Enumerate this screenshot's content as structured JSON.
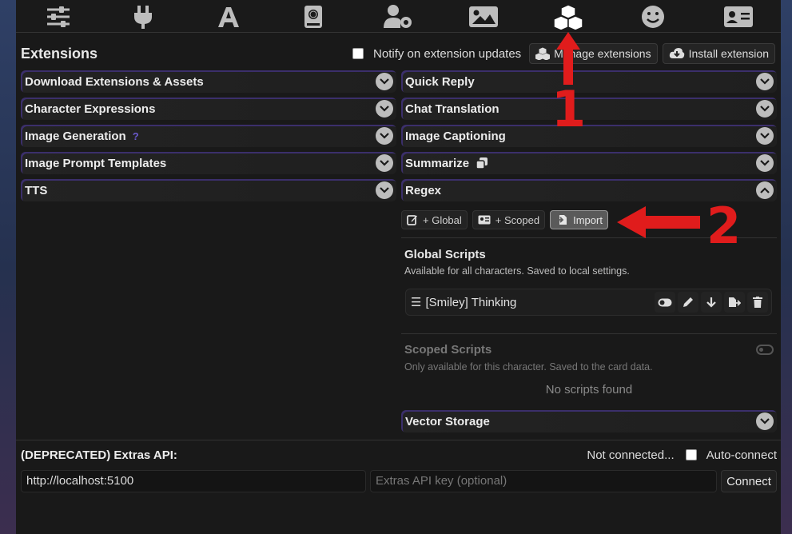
{
  "topbar": {
    "icons": [
      "sliders-icon",
      "plug-icon",
      "font-icon",
      "book-globe-icon",
      "user-cog-icon",
      "image-icon",
      "cubes-icon",
      "smiley-icon",
      "id-card-icon"
    ]
  },
  "extensions": {
    "title": "Extensions",
    "notify_label": "Notify on extension updates",
    "manage_label": "Manage extensions",
    "install_label": "Install extension"
  },
  "left_drawers": [
    {
      "label": "Download Extensions & Assets"
    },
    {
      "label": "Character Expressions"
    },
    {
      "label": "Image Generation",
      "hint": "?"
    },
    {
      "label": "Image Prompt Templates"
    },
    {
      "label": "TTS"
    }
  ],
  "right_drawers": [
    {
      "label": "Quick Reply"
    },
    {
      "label": "Chat Translation"
    },
    {
      "label": "Image Captioning"
    },
    {
      "label": "Summarize"
    },
    {
      "label": "Regex"
    }
  ],
  "regex": {
    "global_btn": "+ Global",
    "scoped_btn": "+ Scoped",
    "import_btn": "Import",
    "global_title": "Global Scripts",
    "global_sub": "Available for all characters. Saved to local settings.",
    "script_name": "[Smiley] Thinking",
    "scoped_title": "Scoped Scripts",
    "scoped_sub": "Only available for this character. Saved to the card data.",
    "no_scripts": "No scripts found"
  },
  "vector_storage": {
    "label": "Vector Storage"
  },
  "extras": {
    "title": "(DEPRECATED) Extras API:",
    "status": "Not connected...",
    "autoconnect_label": "Auto-connect",
    "url_value": "http://localhost:5100",
    "key_placeholder": "Extras API key (optional)",
    "connect_label": "Connect"
  },
  "annotations": {
    "one": "1",
    "two": "2"
  },
  "colors": {
    "annotation": "#e01c1c",
    "chevron": "#bdbdbd",
    "accent": "#3b2f6b"
  }
}
